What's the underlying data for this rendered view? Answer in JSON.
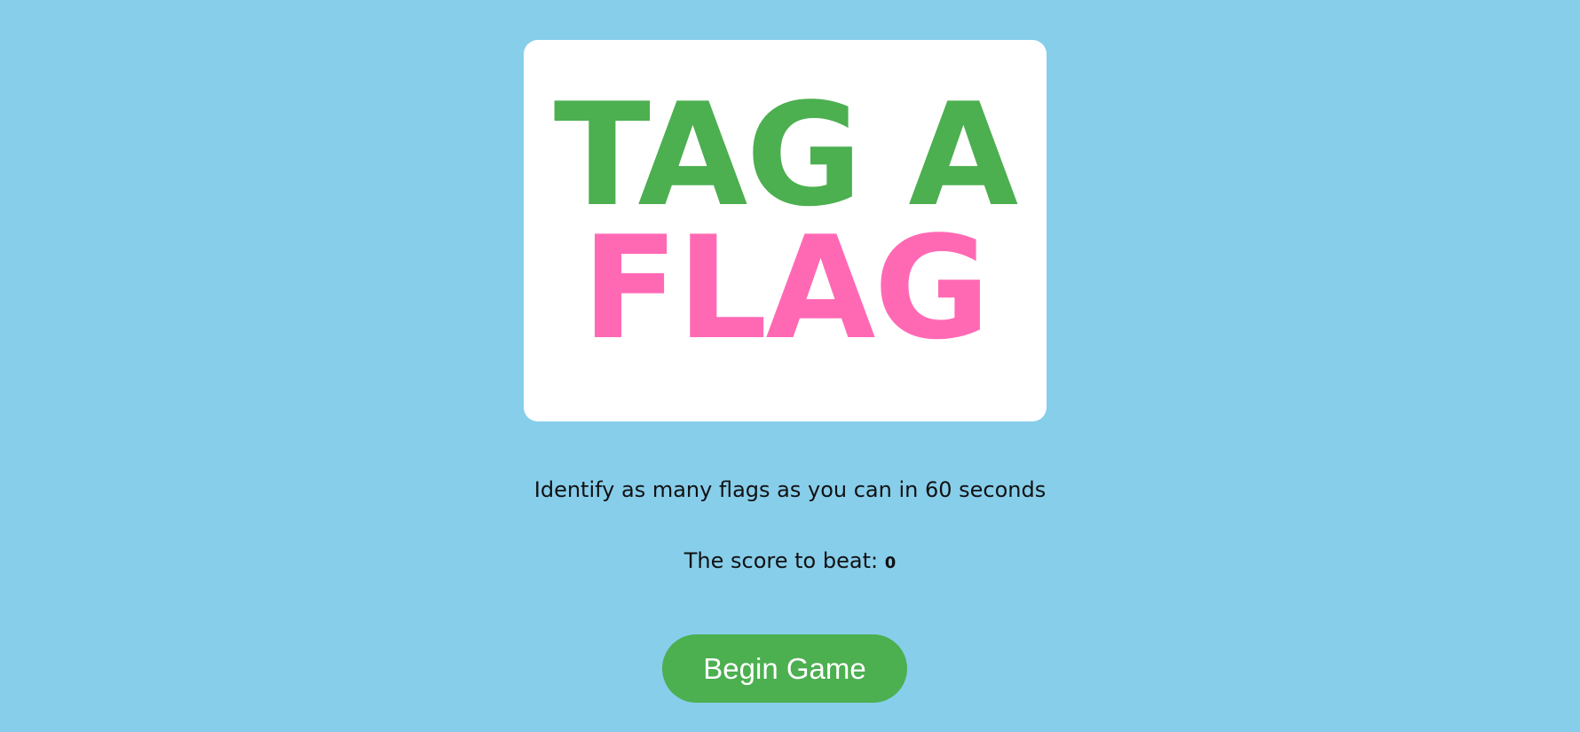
{
  "logo": {
    "line1": "TAG A",
    "line2": "FLAG",
    "line1_color": "#4CAF50",
    "line2_color": "#FF69B4"
  },
  "instruction": "Identify as many flags as you can in 60 seconds",
  "score": {
    "label": "The score to beat: ",
    "value": "0"
  },
  "begin_button": {
    "label": "Begin Game",
    "color": "#4CAF50"
  },
  "colors": {
    "background": "#87CEEB",
    "card": "#FFFFFF"
  }
}
